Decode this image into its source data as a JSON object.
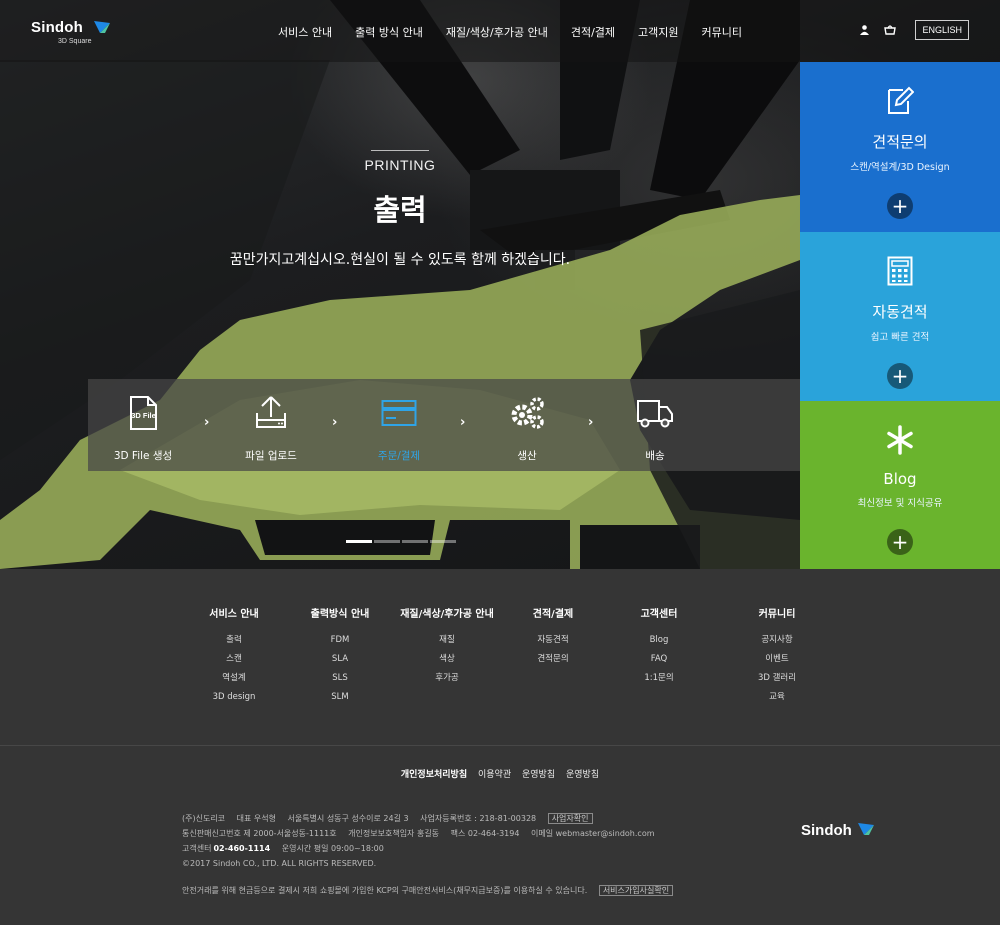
{
  "header": {
    "logo": "Sindoh",
    "logo_sub": "3D Square",
    "nav": [
      "서비스 안내",
      "출력 방식 안내",
      "재질/색상/후가공 안내",
      "견적/결제",
      "고객지원",
      "커뮤니티"
    ],
    "lang_button": "ENGLISH",
    "icons": [
      "user-icon",
      "cart-icon"
    ]
  },
  "hero": {
    "eyebrow": "PRINTING",
    "title": "출력",
    "description": "꿈만가지고계십시오.현실이 될 수 있도록 함께 하겠습니다.",
    "slide_indicators": 4,
    "active_slide": 1,
    "accent_color": "#2fa4e7"
  },
  "steps": [
    {
      "label": "3D File 생성",
      "icon": "3d-file-icon",
      "icon_text": "3D File",
      "active": false
    },
    {
      "label": "파일 업로드",
      "icon": "upload-icon",
      "active": false
    },
    {
      "label": "주문/결제",
      "icon": "card-icon",
      "active": true
    },
    {
      "label": "생산",
      "icon": "gears-icon",
      "active": false
    },
    {
      "label": "배송",
      "icon": "truck-icon",
      "active": false
    }
  ],
  "panels": [
    {
      "title": "견적문의",
      "subtitle": "스캔/역설계/3D Design",
      "icon": "edit-icon",
      "color": "#1a6fce"
    },
    {
      "title": "자동견적",
      "subtitle": "쉽고 빠른 견적",
      "icon": "calculator-icon",
      "color": "#2aa3da"
    },
    {
      "title": "Blog",
      "subtitle": "최신정보 및 지식공유",
      "icon": "asterisk-icon",
      "color": "#6ab42d"
    }
  ],
  "footer_nav": [
    {
      "heading": "서비스 안내",
      "items": [
        "출력",
        "스캔",
        "역설계",
        "3D design"
      ]
    },
    {
      "heading": "출력방식 안내",
      "items": [
        "FDM",
        "SLA",
        "SLS",
        "SLM"
      ]
    },
    {
      "heading": "재질/색상/후가공 안내",
      "items": [
        "재질",
        "색상",
        "후가공"
      ]
    },
    {
      "heading": "견적/결제",
      "items": [
        "자동견적",
        "견적문의"
      ]
    },
    {
      "heading": "고객센터",
      "items": [
        "Blog",
        "FAQ",
        "1:1문의"
      ]
    },
    {
      "heading": "커뮤니티",
      "items": [
        "공지사항",
        "이벤트",
        "3D 갤러리",
        "교육"
      ]
    }
  ],
  "policy_links": [
    "개인정보처리방침",
    "이용약관",
    "운영방침",
    "운영방침"
  ],
  "company": {
    "name": "(주)신도리코",
    "ceo": "대표 우석형",
    "address": "서울특별시 성동구 성수이로 24길 3",
    "biz_no": "사업자등록번호 : 218-81-00328",
    "biz_btn": "사업자확인",
    "mail_order": "통신판매신고번호 제 2000-서울성동-1111호",
    "privacy_officer": "개인정보보호책임자 홍길동",
    "fax": "팩스 02-464-3194",
    "email": "이메일 webmaster@sindoh.com",
    "cs_label": "고객센터",
    "cs_phone": "02-460-1114",
    "hours": "운영시간 평일 09:00~18:00",
    "copyright": "©2017 Sindoh CO., LTD. ALL RIGHTS RESERVED.",
    "escrow_note": "안전거래를 위해 현금등으로 결제시 저희 쇼핑몰에 가입한 KCP의 구매안전서비스(채무지급보증)를 이용하실 수 있습니다.",
    "escrow_btn": "서비스가입사실확인"
  },
  "footer_logo": "Sindoh"
}
